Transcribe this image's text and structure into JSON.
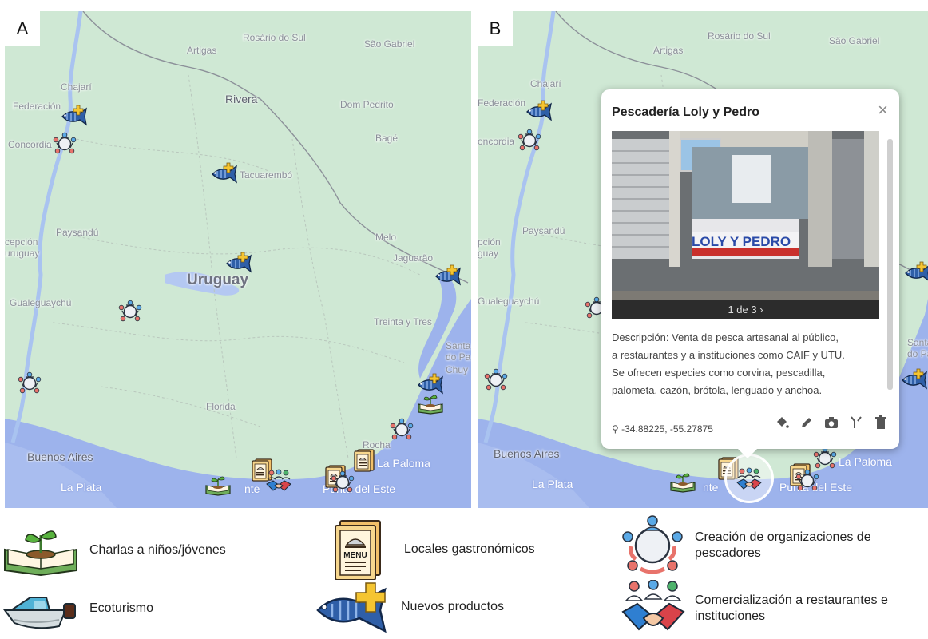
{
  "panels": {
    "a_label": "A",
    "b_label": "B"
  },
  "places": {
    "rosario": "Rosário do Sul",
    "sao_gabriel": "São Gabriel",
    "artigas": "Artigas",
    "chajari": "Chajarí",
    "federacion": "Federación",
    "rivera": "Rivera",
    "dom_pedrito": "Dom Pedrito",
    "concordia": "Concordia",
    "bage": "Bagé",
    "tacuarembo": "Tacuarembó",
    "concordia_b": "oncordia",
    "paysandu": "Paysandú",
    "melo": "Melo",
    "concepcion": "cepción",
    "uruguay_town": "uruguay",
    "concepcion_b": "pción",
    "uruguay_town_b": "guay",
    "jaguarao": "Jaguarão",
    "uruguay": "Uruguay",
    "gualeguaychu": "Gualeguaychú",
    "treinta_y_tres": "Treinta y Tres",
    "santa_vitoria": "Santa",
    "do_palmar": "do Pa",
    "chuy": "Chuy",
    "florida": "Florida",
    "rocha": "Rocha",
    "buenos_aires": "Buenos Aires",
    "la_paloma": "La Paloma",
    "la_plata": "La Plata",
    "montevideo_frag": "nte",
    "punta_del_este": "Punta del Este"
  },
  "popup": {
    "title": "Pescadería Loly y Pedro",
    "close": "×",
    "sign_text": "LOLY Y PEDRO",
    "photo_caption": "1 de 3 ›",
    "desc_lines": [
      "Descripción: Venta de pesca artesanal al público,",
      "a restaurantes y a instituciones como CAIF y UTU.",
      "Se ofrecen especies como corvina, pescadilla,",
      "palometa, cazón, brótola, lenguado y anchoa."
    ],
    "coords": "-34.88225, -55.27875"
  },
  "legend": {
    "charlas": "Charlas a niños/jóvenes",
    "locales": "Locales gastronómicos",
    "organizaciones_1": "Creación de organizaciones de",
    "organizaciones_2": "pescadores",
    "ecoturismo": "Ecoturismo",
    "nuevos": "Nuevos productos",
    "comercializacion_1": "Comercialización a restaurantes e",
    "comercializacion_2": "instituciones",
    "menu_text": "MENU"
  },
  "colors": {
    "land": "#cfe8d4",
    "water": "#9db3ec",
    "river": "#a9c3f0",
    "border": "#8c9099",
    "fish": "#2f5fa8",
    "plus": "#f5c531",
    "org": "#e8736b"
  }
}
